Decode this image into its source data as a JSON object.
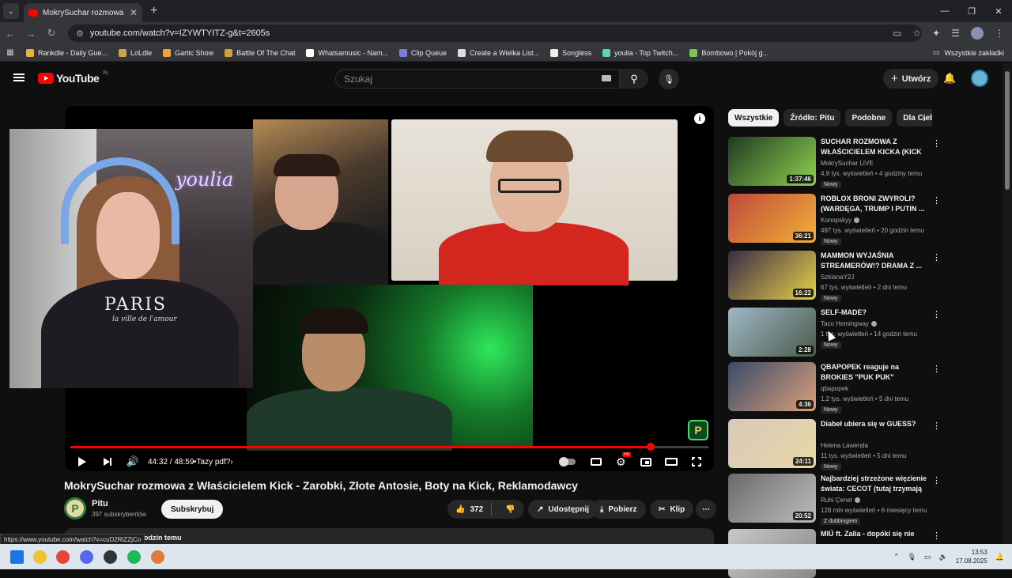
{
  "browser": {
    "tab_title": "MokrySuchar rozmowa z Właścicielem Kick - Zarobki",
    "url": "youtube.com/watch?v=IZYWTYITZ-g&t=2605s",
    "bookmarks": [
      {
        "label": "Rankdle - Daily Gue...",
        "color": "#e5b53a"
      },
      {
        "label": "LoLdle",
        "color": "#c8a44a"
      },
      {
        "label": "Gartic Show",
        "color": "#f2a33a"
      },
      {
        "label": "Battle Of The Chat",
        "color": "#d4a23c"
      },
      {
        "label": "Whatsamusic - Nam...",
        "color": "#ffffff"
      },
      {
        "label": "Clip Queue",
        "color": "#7d7de0"
      },
      {
        "label": "Create a Wielka List...",
        "color": "#dddddd"
      },
      {
        "label": "Songless",
        "color": "#eeeeee"
      },
      {
        "label": "youlia - Top Twitch...",
        "color": "#5fd3b2"
      },
      {
        "label": "Bombowo | Pokój g...",
        "color": "#79c35a"
      }
    ],
    "all_bookmarks": "Wszystkie zakładki",
    "status_url": "https://www.youtube.com/watch?v=cuD2RlZZjCo"
  },
  "header": {
    "logo": "YouTube",
    "region": "PL",
    "search_placeholder": "Szukaj",
    "create_label": "Utwórz"
  },
  "player": {
    "time": "44:32 / 48:59",
    "chapter": "Tazy pdf?",
    "progress": 0.909,
    "channel_watermark": "P"
  },
  "overlay": {
    "neon_sign": "youlia",
    "shirt_text": "PARIS",
    "shirt_sub": "la ville de l'amour"
  },
  "video": {
    "title": "MokrySuchar rozmowa z Właścicielem Kick - Zarobki, Złote Antosie, Boty na Kick, Reklamodawcy",
    "channel": "Pitu",
    "avatar_letter": "P",
    "subscribers": "397 subskrybentów",
    "subscribe": "Subskrybuj",
    "likes": "372",
    "share": "Udostępnij",
    "download": "Pobierz",
    "clip": "Klip",
    "description_tail": "odzin temu"
  },
  "chips": [
    "Wszystkie",
    "Źródło: Pitu",
    "Podobne",
    "Dla Ciebie"
  ],
  "recommendations": [
    {
      "title": "SUCHAR ROZMOWA Z WŁAŚCICIELEM KICKA (KICK ...",
      "channel": "MokrySuchar LIVE",
      "verified": false,
      "meta": "4,9 tys. wyświetleń • 4 godziny temu",
      "badge": "Nowy",
      "duration": "1:37:46",
      "colors": [
        "#1f3b22",
        "#8fd14f"
      ]
    },
    {
      "title": "ROBLOX BRONI ZWYROLI? (WARDĘGA, TRUMP I PUTIN ...",
      "channel": "Konopskyy",
      "verified": true,
      "meta": "497 tys. wyświetleń • 20 godzin temu",
      "badge": "Nowy",
      "duration": "36:21",
      "colors": [
        "#c0473a",
        "#f0b23a"
      ]
    },
    {
      "title": "MAMMON WYJAŚNIA STREAMERÓW!? DRAMA Z ...",
      "channel": "SzklanaY2J",
      "verified": false,
      "meta": "67 tys. wyświetleń • 2 dni temu",
      "badge": "Nowy",
      "duration": "16:22",
      "colors": [
        "#3a2a44",
        "#e6d24a"
      ]
    },
    {
      "title": "SELF-MADE?",
      "channel": "Taco Hemingway",
      "verified": true,
      "meta": "1 tys. wyświetleń • 14 godzin temu",
      "badge": "Nowy",
      "duration": "2:28",
      "colors": [
        "#9fb8c8",
        "#4a5a4a"
      ]
    },
    {
      "title": "QBAPOPEK reaguje na BROKIES \"PUK PUK\"",
      "channel": "qbapopek",
      "verified": false,
      "meta": "1,2 tys. wyświetleń • 5 dni temu",
      "badge": "Nowy",
      "duration": "4:36",
      "colors": [
        "#3a4a6a",
        "#d9a07a"
      ]
    },
    {
      "title": "Diabeł ubiera się w GUESS?",
      "channel": "Helena Lawenda",
      "verified": false,
      "meta": "11 tys. wyświetleń • 5 dni temu",
      "badge": "Nowy",
      "duration": "24:11",
      "colors": [
        "#d9c8b8",
        "#e8d8a8"
      ]
    },
    {
      "title": "Najbardziej strzeżone więzienie świata: CECOT (tutaj trzymają ...",
      "channel": "Ruhi Çenet",
      "verified": true,
      "meta": "128 mln wyświetleń • 6 miesięcy temu",
      "badge": "Z dubbingiem",
      "duration": "20:52",
      "colors": [
        "#6a6a6a",
        "#bdbdbd"
      ]
    },
    {
      "title": "MIÚ ft. Zalia - dopóki się nie",
      "channel": "",
      "verified": false,
      "meta": "",
      "badge": "",
      "duration": "",
      "colors": [
        "#c8c8c8",
        "#888888"
      ]
    }
  ],
  "taskbar": {
    "time": "13:53",
    "date": "17.08.2025",
    "apps": [
      {
        "name": "windows-start-icon",
        "color": "#1a73e8"
      },
      {
        "name": "file-explorer-icon",
        "color": "#f2c230"
      },
      {
        "name": "chrome-icon",
        "color": "#ea4335"
      },
      {
        "name": "discord-icon",
        "color": "#5865f2"
      },
      {
        "name": "obs-icon",
        "color": "#333333"
      },
      {
        "name": "spotify-icon",
        "color": "#1db954"
      },
      {
        "name": "chrome-active-icon",
        "color": "#e07b39"
      }
    ]
  }
}
